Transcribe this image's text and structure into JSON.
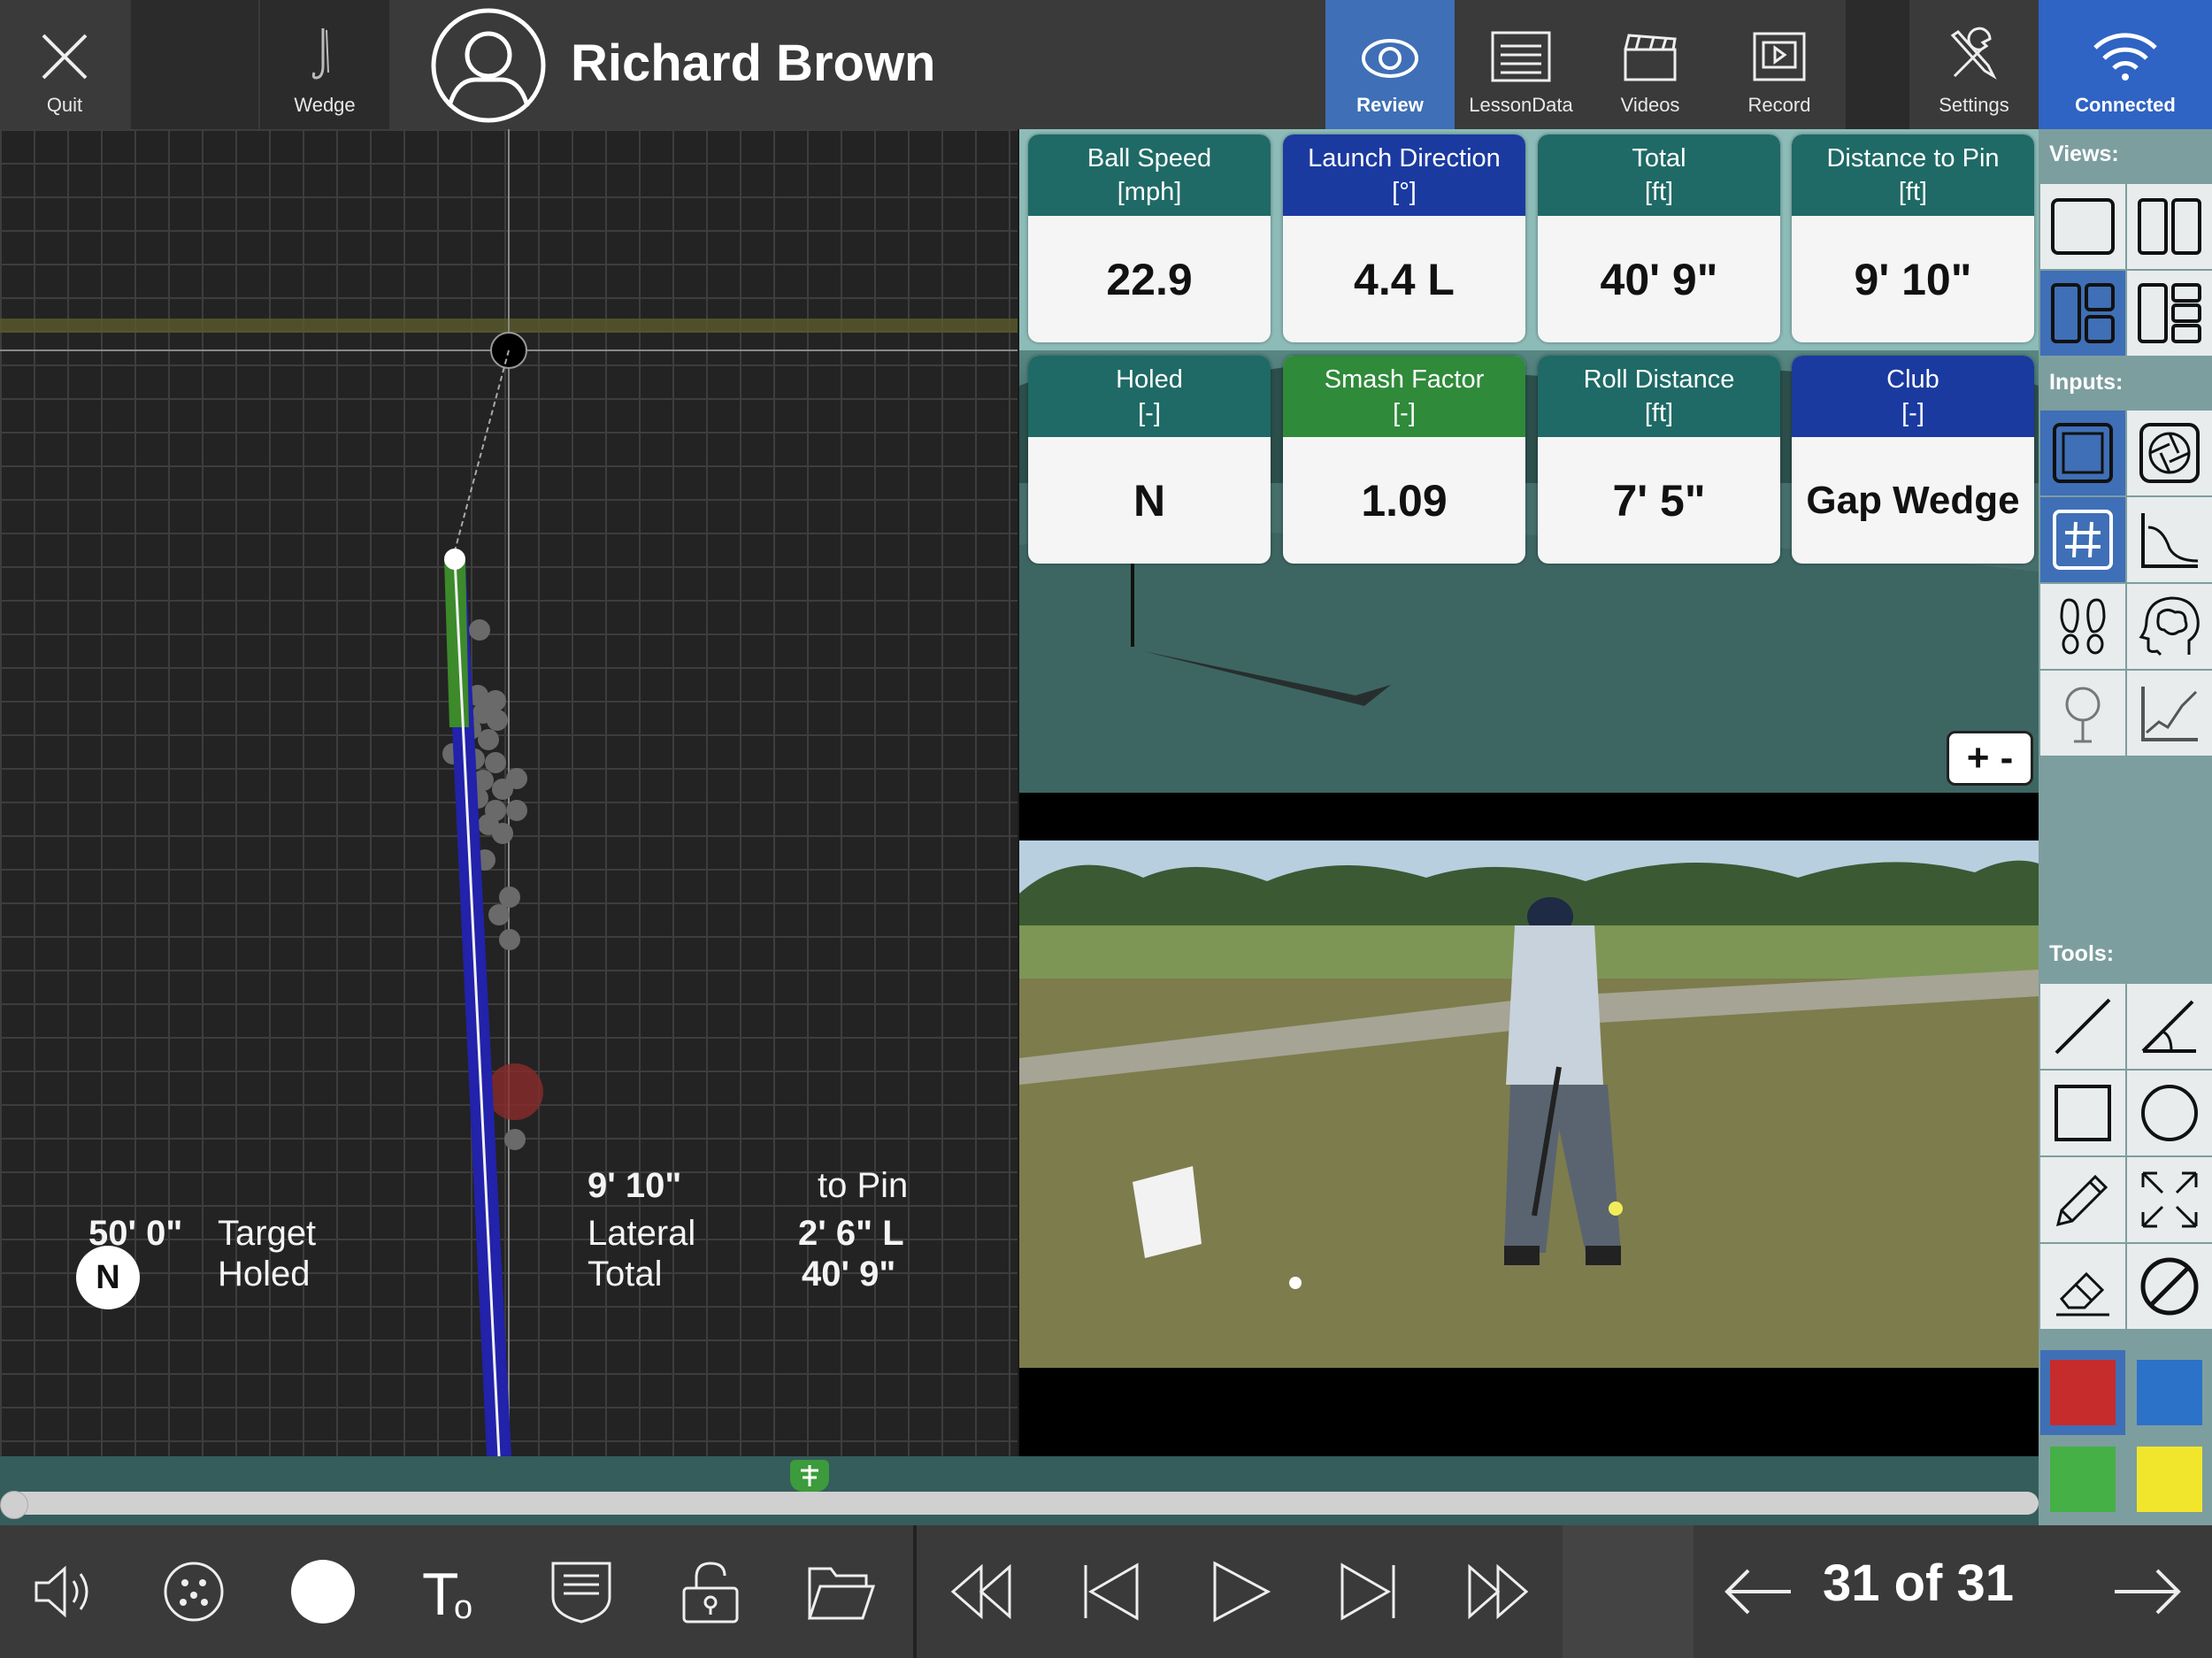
{
  "topbar": {
    "quit_label": "Quit",
    "club_label": "Wedge",
    "user_name": "Richard Brown",
    "review_label": "Review",
    "lessondata_label": "LessonData",
    "videos_label": "Videos",
    "record_label": "Record",
    "settings_label": "Settings",
    "connected_label": "Connected"
  },
  "grid_stats": {
    "target_value": "50' 0\"",
    "target_label": "Target",
    "holed_value": "N",
    "holed_label": "Holed",
    "to_pin_value": "9' 10\"",
    "to_pin_label": "to Pin",
    "lateral_label": "Lateral",
    "lateral_value": "2' 6\" L",
    "total_label": "Total",
    "total_value": "40' 9\""
  },
  "tiles": [
    {
      "name": "Ball Speed",
      "unit": "[mph]",
      "value": "22.9",
      "color": "#1f6a66"
    },
    {
      "name": "Launch Direction",
      "unit": "[°]",
      "value": "4.4 L",
      "color": "#1b3aa0"
    },
    {
      "name": "Total",
      "unit": "[ft]",
      "value": "40' 9\"",
      "color": "#1f6a66"
    },
    {
      "name": "Distance to Pin",
      "unit": "[ft]",
      "value": "9' 10\"",
      "color": "#1f6a66"
    },
    {
      "name": "Holed",
      "unit": "[-]",
      "value": "N",
      "color": "#1f6a66"
    },
    {
      "name": "Smash Factor",
      "unit": "[-]",
      "value": "1.09",
      "color": "#2f8a3a"
    },
    {
      "name": "Roll Distance",
      "unit": "[ft]",
      "value": "7' 5\"",
      "color": "#1f6a66"
    },
    {
      "name": "Club",
      "unit": "[-]",
      "value": "Gap Wedge",
      "color": "#1b3aa0"
    }
  ],
  "zoom_control": "+ -",
  "sidebar": {
    "views_title": "Views:",
    "inputs_title": "Inputs:",
    "tools_title": "Tools:",
    "colors": [
      "#c62c2c",
      "#2c72c9",
      "#45b045",
      "#f2e62c"
    ]
  },
  "pager": {
    "text": "31 of 31"
  },
  "accent": {
    "active_blue": "#3f6fb6",
    "connected_blue": "#2f63c4",
    "teal": "#1f6a66",
    "navy": "#1b3aa0",
    "green": "#2f8a3a"
  }
}
